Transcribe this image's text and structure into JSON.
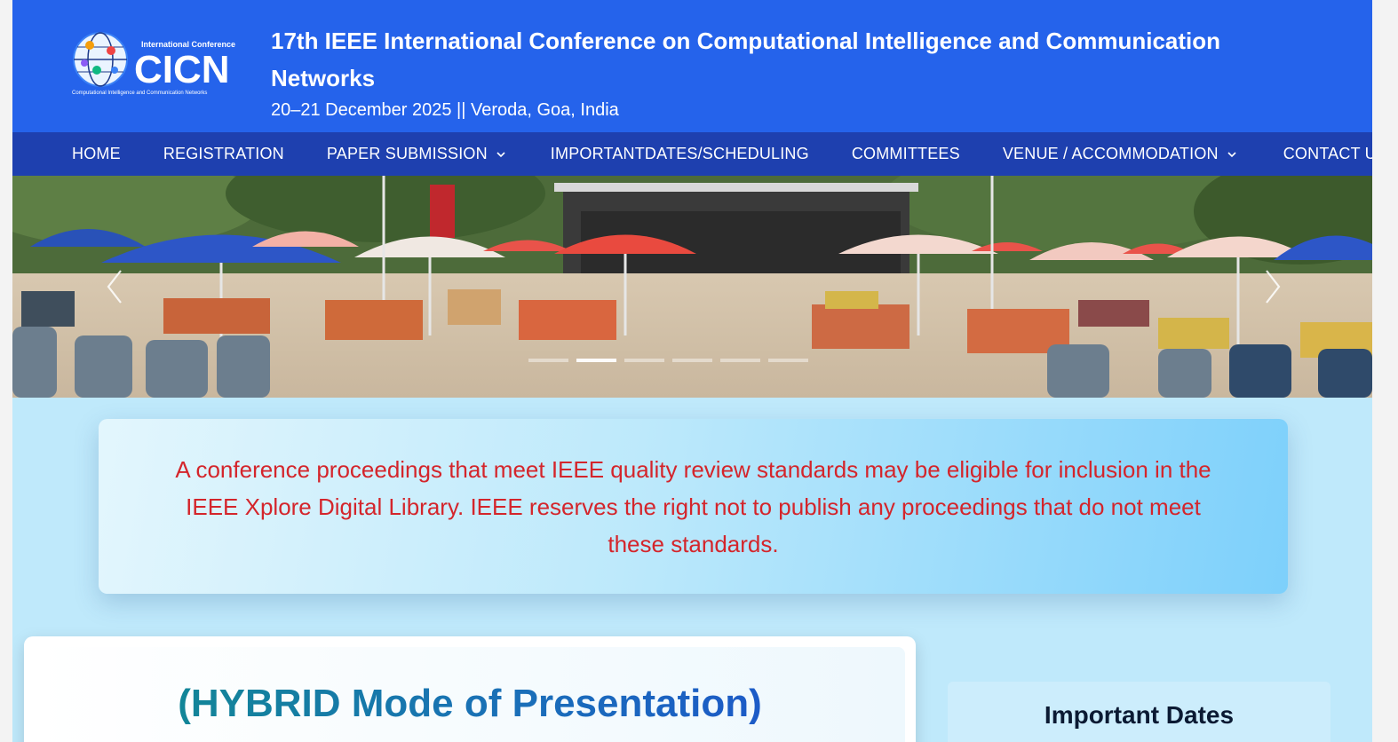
{
  "header": {
    "logo_text": "CICN",
    "logo_tagline_top": "International Conference",
    "logo_tagline_bottom": "Computational Intelligence and Communication Networks",
    "title": "17th IEEE International Conference on Computational Intelligence and Communication Networks",
    "subtitle": "20–21 December 2025 || Veroda, Goa, India"
  },
  "nav": {
    "items": [
      {
        "label": "HOME",
        "has_dropdown": false
      },
      {
        "label": "REGISTRATION",
        "has_dropdown": false
      },
      {
        "label": "PAPER SUBMISSION",
        "has_dropdown": true
      },
      {
        "label": "IMPORTANTDATES/SCHEDULING",
        "has_dropdown": false
      },
      {
        "label": "COMMITTEES",
        "has_dropdown": false
      },
      {
        "label": "VENUE / ACCOMMODATION",
        "has_dropdown": true
      },
      {
        "label": "CONTACT US",
        "has_dropdown": false
      }
    ]
  },
  "carousel": {
    "slide_count": 6,
    "active_index": 1
  },
  "notice": {
    "text": "A conference proceedings that meet IEEE quality review standards may be eligible for inclusion in the IEEE Xplore Digital Library. IEEE reserves the right not to publish any proceedings that do not meet these standards."
  },
  "main": {
    "heading": "(HYBRID Mode of Presentation)"
  },
  "sidebar": {
    "title": "Important Dates"
  },
  "colors": {
    "header_bg": "#2563eb",
    "nav_bg": "#1e40af",
    "notice_text": "#d4252b",
    "page_bg": "#bfe9fb"
  }
}
